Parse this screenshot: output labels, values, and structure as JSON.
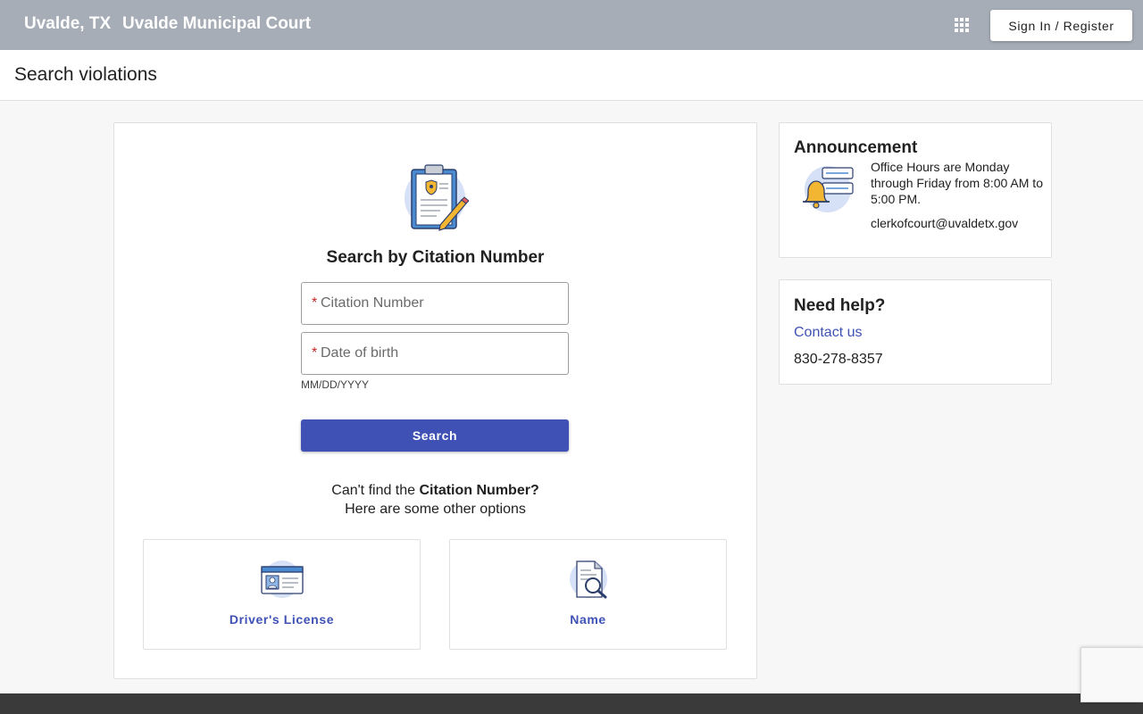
{
  "header": {
    "city": "Uvalde, TX",
    "court": "Uvalde Municipal Court",
    "signin_label": "Sign In / Register",
    "bg_color": "#a6adb6"
  },
  "page": {
    "title": "Search violations"
  },
  "search": {
    "title": "Search by Citation Number",
    "citation_placeholder": "Citation Number",
    "citation_value": "",
    "dob_placeholder": "Date of birth",
    "dob_value": "",
    "dob_hint": "MM/DD/YYYY",
    "button_label": "Search",
    "button_color": "#3f51b5",
    "cant_find_prefix": "Can't find the ",
    "cant_find_bold": "Citation Number?",
    "other_options": "Here are some other options"
  },
  "options": [
    {
      "label": "Driver's License",
      "icon": "drivers-license-icon"
    },
    {
      "label": "Name",
      "icon": "name-search-icon"
    }
  ],
  "announcement": {
    "title": "Announcement",
    "message": "Office Hours are Monday through Friday from 8:00 AM to 5:00 PM.",
    "email": "clerkofcourt@uvaldetx.gov"
  },
  "help": {
    "title": "Need help?",
    "contact_label": "Contact us",
    "phone": "830-278-8357"
  }
}
